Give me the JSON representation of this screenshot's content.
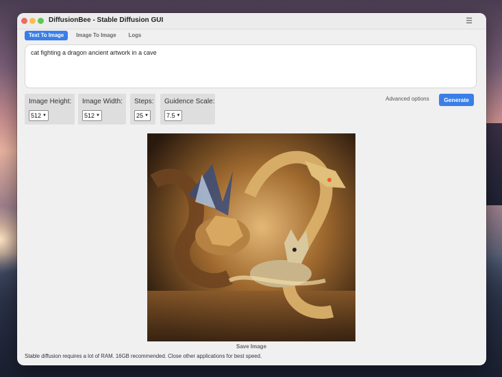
{
  "window": {
    "title": "DiffusionBee - Stable Diffusion GUI",
    "menu_icon": "hamburger-menu-icon"
  },
  "tabs": [
    {
      "label": "Text To Image",
      "active": true
    },
    {
      "label": "Image To Image",
      "active": false
    },
    {
      "label": "Logs",
      "active": false
    }
  ],
  "prompt": {
    "value": "cat fighting a dragon ancient artwork in a cave"
  },
  "options": {
    "height": {
      "label": "Image Height:",
      "value": "512"
    },
    "width": {
      "label": "Image Width:",
      "value": "512"
    },
    "steps": {
      "label": "Steps:",
      "value": "25"
    },
    "guidance": {
      "label": "Guidence Scale:",
      "value": "7.5"
    }
  },
  "actions": {
    "advanced_label": "Advanced options",
    "generate_label": "Generate",
    "save_label": "Save Image"
  },
  "footer": {
    "note": "Stable diffusion requires a lot of RAM. 16GB recommended. Close other applications for best speed."
  },
  "colors": {
    "accent": "#3a7ee8",
    "window_bg": "#f0f0f0"
  }
}
